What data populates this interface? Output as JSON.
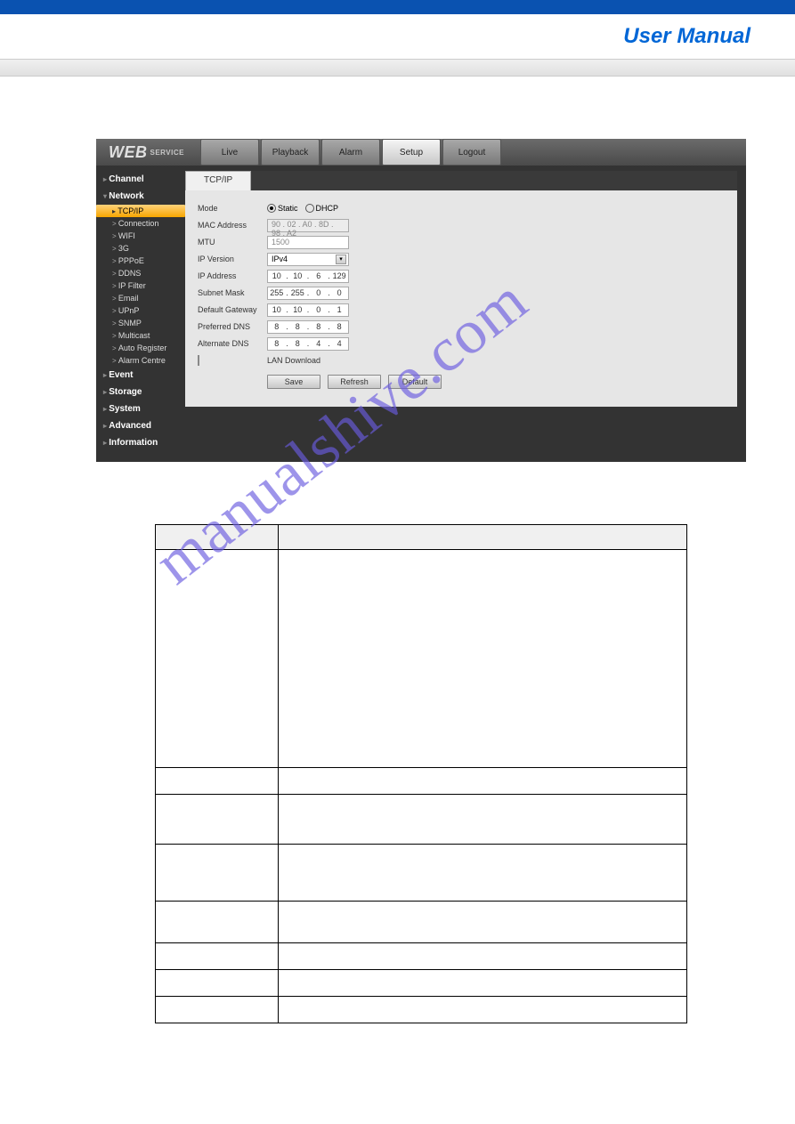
{
  "doc": {
    "header_title": "User Manual",
    "watermark": "manualshive.com"
  },
  "app": {
    "logo_main": "WEB",
    "logo_sub": "SERVICE",
    "topnav": [
      {
        "label": "Live",
        "active": false
      },
      {
        "label": "Playback",
        "active": false
      },
      {
        "label": "Alarm",
        "active": false
      },
      {
        "label": "Setup",
        "active": true
      },
      {
        "label": "Logout",
        "active": false
      }
    ],
    "sidebar": {
      "categories": [
        {
          "label": "Channel",
          "open": false,
          "subs": []
        },
        {
          "label": "Network",
          "open": true,
          "subs": [
            {
              "label": "TCP/IP",
              "active": true
            },
            {
              "label": "Connection",
              "active": false
            },
            {
              "label": "WIFI",
              "active": false
            },
            {
              "label": "3G",
              "active": false
            },
            {
              "label": "PPPoE",
              "active": false
            },
            {
              "label": "DDNS",
              "active": false
            },
            {
              "label": "IP Filter",
              "active": false
            },
            {
              "label": "Email",
              "active": false
            },
            {
              "label": "UPnP",
              "active": false
            },
            {
              "label": "SNMP",
              "active": false
            },
            {
              "label": "Multicast",
              "active": false
            },
            {
              "label": "Auto Register",
              "active": false
            },
            {
              "label": "Alarm Centre",
              "active": false
            }
          ]
        },
        {
          "label": "Event",
          "open": false,
          "subs": []
        },
        {
          "label": "Storage",
          "open": false,
          "subs": []
        },
        {
          "label": "System",
          "open": false,
          "subs": []
        },
        {
          "label": "Advanced",
          "open": false,
          "subs": []
        },
        {
          "label": "Information",
          "open": false,
          "subs": []
        }
      ]
    },
    "tab_label": "TCP/IP",
    "form": {
      "mode_label": "Mode",
      "mode_static": "Static",
      "mode_dhcp": "DHCP",
      "mode_value": "Static",
      "mac_label": "MAC Address",
      "mac_value": "90 . 02 . A0 . 8D . 98 . A2",
      "mtu_label": "MTU",
      "mtu_value": "1500",
      "ipver_label": "IP Version",
      "ipver_value": "IPv4",
      "ipaddr_label": "IP Address",
      "ipaddr": [
        "10",
        "10",
        "6",
        "129"
      ],
      "subnet_label": "Subnet Mask",
      "subnet": [
        "255",
        "255",
        "0",
        "0"
      ],
      "gateway_label": "Default Gateway",
      "gateway": [
        "10",
        "10",
        "0",
        "1"
      ],
      "pdns_label": "Preferred DNS",
      "pdns": [
        "8",
        "8",
        "8",
        "8"
      ],
      "adns_label": "Alternate DNS",
      "adns": [
        "8",
        "8",
        "4",
        "4"
      ],
      "lan_label": "LAN Download",
      "btn_save": "Save",
      "btn_refresh": "Refresh",
      "btn_default": "Default"
    }
  }
}
